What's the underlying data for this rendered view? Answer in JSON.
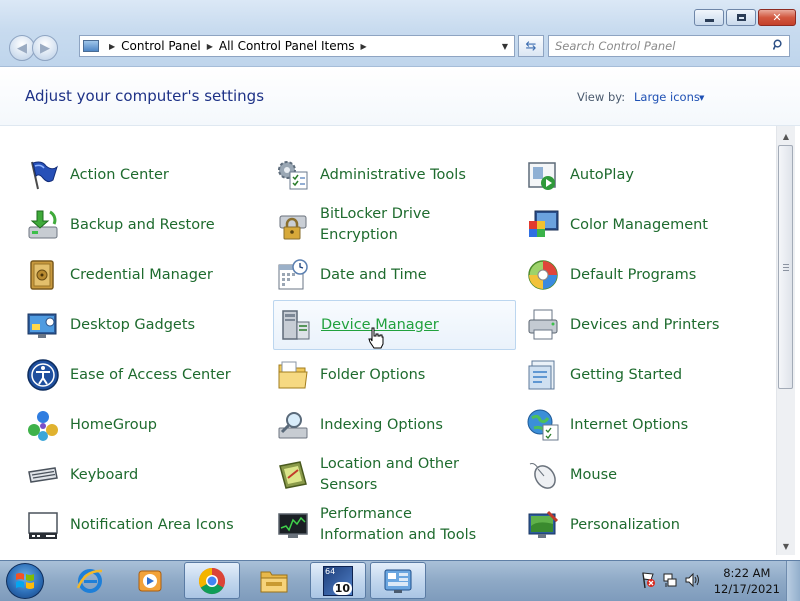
{
  "breadcrumb": [
    "Control Panel",
    "All Control Panel Items"
  ],
  "search": {
    "placeholder": "Search Control Panel"
  },
  "header": {
    "title": "Adjust your computer's settings",
    "view_by_label": "View by:",
    "view_by_value": "Large icons"
  },
  "items": [
    {
      "label": "Action Center",
      "icon": "flag-icon"
    },
    {
      "label": "Administrative Tools",
      "icon": "admin-tools-icon"
    },
    {
      "label": "AutoPlay",
      "icon": "autoplay-icon"
    },
    {
      "label": "Backup and Restore",
      "icon": "backup-icon"
    },
    {
      "label": "BitLocker Drive Encryption",
      "icon": "bitlocker-icon"
    },
    {
      "label": "Color Management",
      "icon": "color-management-icon"
    },
    {
      "label": "Credential Manager",
      "icon": "vault-icon"
    },
    {
      "label": "Date and Time",
      "icon": "calendar-clock-icon"
    },
    {
      "label": "Default Programs",
      "icon": "default-programs-icon"
    },
    {
      "label": "Desktop Gadgets",
      "icon": "gadgets-icon"
    },
    {
      "label": "Device Manager",
      "icon": "device-manager-icon"
    },
    {
      "label": "Devices and Printers",
      "icon": "printer-icon"
    },
    {
      "label": "Ease of Access Center",
      "icon": "ease-of-access-icon"
    },
    {
      "label": "Folder Options",
      "icon": "folder-icon"
    },
    {
      "label": "Getting Started",
      "icon": "getting-started-icon"
    },
    {
      "label": "HomeGroup",
      "icon": "homegroup-icon"
    },
    {
      "label": "Indexing Options",
      "icon": "magnifier-icon"
    },
    {
      "label": "Internet Options",
      "icon": "globe-icon"
    },
    {
      "label": "Keyboard",
      "icon": "keyboard-icon"
    },
    {
      "label": "Location and Other Sensors",
      "icon": "sensors-icon"
    },
    {
      "label": "Mouse",
      "icon": "mouse-icon"
    },
    {
      "label": "Notification Area Icons",
      "icon": "notification-icon"
    },
    {
      "label": "Performance Information and Tools",
      "icon": "performance-icon"
    },
    {
      "label": "Personalization",
      "icon": "personalization-icon"
    }
  ],
  "hovered_item": "Device Manager",
  "taskbar": {
    "apps": [
      "internet-explorer-icon",
      "media-player-icon",
      "chrome-icon",
      "file-explorer-icon",
      "app-64-10-icon",
      "control-panel-icon"
    ],
    "badge_top": "64",
    "badge_bottom": "10",
    "active_app": "control-panel-icon",
    "time": "8:22 AM",
    "date": "12/17/2021"
  },
  "colors": {
    "item_link": "#1e6b2e",
    "item_hover": "#21a13d",
    "title": "#1e3287",
    "view_link": "#1e50b4"
  }
}
